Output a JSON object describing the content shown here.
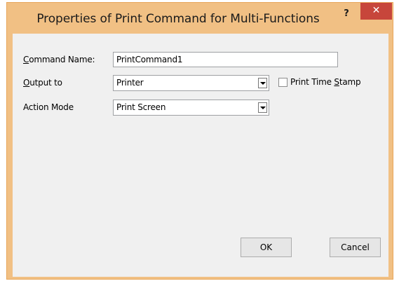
{
  "window": {
    "title": "Properties of Print Command for Multi-Functions",
    "help_label": "?",
    "close_label": "✕"
  },
  "form": {
    "command_name": {
      "label_accel": "C",
      "label_rest": "ommand Name:",
      "value": "PrintCommand1"
    },
    "output_to": {
      "label_accel": "O",
      "label_rest": "utput to",
      "value": "Printer"
    },
    "print_time_stamp": {
      "label_pre": "Print Time ",
      "label_accel": "S",
      "label_post": "tamp",
      "checked": false
    },
    "action_mode": {
      "label": "Action Mode",
      "value": "Print Screen"
    }
  },
  "buttons": {
    "ok_label": "OK",
    "cancel_label": "Cancel"
  },
  "colors": {
    "frame": "#f1c084",
    "close_button": "#c7463b",
    "client": "#f0f0f0"
  }
}
